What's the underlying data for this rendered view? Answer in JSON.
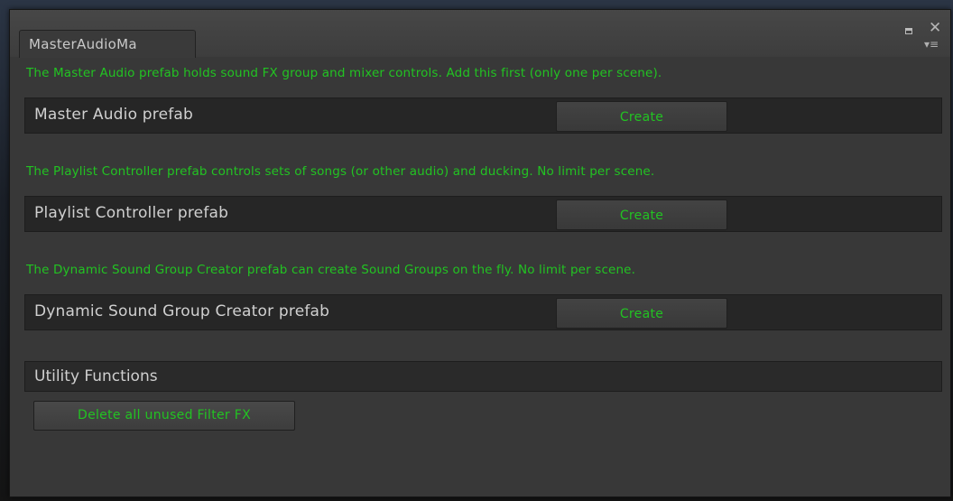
{
  "window": {
    "tab_title": "MasterAudioMa"
  },
  "sections": [
    {
      "info": "The Master Audio prefab holds sound FX group and mixer controls. Add this first (only one per scene).",
      "label": "Master Audio prefab",
      "button": "Create"
    },
    {
      "info": "The Playlist Controller prefab controls sets of songs (or other audio) and ducking. No limit per scene.",
      "label": "Playlist Controller prefab",
      "button": "Create"
    },
    {
      "info": "The Dynamic Sound Group Creator prefab can create Sound Groups on the fly. No limit per scene.",
      "label": "Dynamic Sound Group Creator prefab",
      "button": "Create"
    }
  ],
  "utility": {
    "header": "Utility Functions",
    "button": "Delete all unused Filter FX"
  },
  "colors": {
    "accent_text": "#22c322",
    "panel_bg": "#383838",
    "row_bg": "#262626"
  },
  "icons": {
    "maximize": "maximize-icon",
    "close": "close-icon",
    "menu": "tab-menu-icon"
  }
}
